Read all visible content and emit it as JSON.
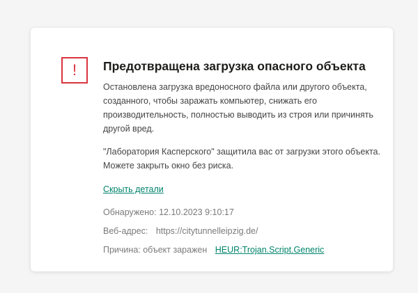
{
  "dialog": {
    "icon": "exclamation-warning-icon",
    "icon_glyph": "!",
    "title": "Предотвращена загрузка опасного объекта",
    "paragraph1": "Остановлена загрузка вредоносного файла или другого объекта, созданного, чтобы заражать компьютер, снижать его производительность, полностью выводить из строя или причинять другой вред.",
    "paragraph2": "\"Лаборатория Касперского\" защитила вас от загрузки этого объекта. Можете закрыть окно без риска.",
    "hide_details_link": "Скрыть детали",
    "details": {
      "detected_label": "Обнаружено:",
      "detected_value": "12.10.2023 9:10:17",
      "url_label": "Веб-адрес:",
      "url_value": "https://citytunnelleipzig.de/",
      "reason_label": "Причина: объект заражен",
      "reason_value": "HEUR:Trojan.Script.Generic"
    }
  },
  "colors": {
    "accent_red": "#d9343e",
    "link_green": "#00836b",
    "background": "#f5f5f5",
    "card": "#ffffff"
  }
}
